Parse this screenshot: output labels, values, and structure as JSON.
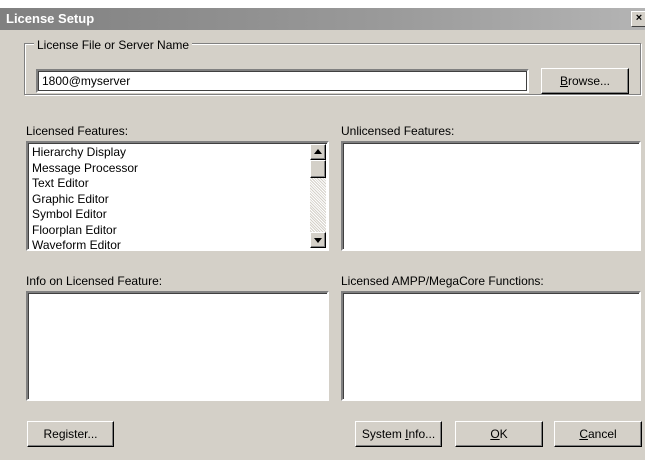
{
  "window": {
    "title": "License Setup",
    "close_glyph": "×"
  },
  "license_group": {
    "legend": "License File or Server Name",
    "value": "1800@myserver",
    "browse_label_underlined": "B",
    "browse_label_rest": "rowse..."
  },
  "licensed_features": {
    "label": "Licensed Features:",
    "items": [
      "Hierarchy Display",
      "Message Processor",
      "Text Editor",
      "Graphic Editor",
      "Symbol Editor",
      "Floorplan Editor",
      "Waveform Editor"
    ]
  },
  "unlicensed_features": {
    "label": "Unlicensed Features:",
    "items": []
  },
  "info_panel": {
    "label": "Info on Licensed Feature:"
  },
  "ampp_panel": {
    "label": "Licensed AMPP/MegaCore Functions:"
  },
  "buttons": {
    "register": "Register...",
    "system_info_prefix": "System ",
    "system_info_underlined": "I",
    "system_info_suffix": "nfo...",
    "ok_underlined": "O",
    "ok_rest": "K",
    "cancel_underlined": "C",
    "cancel_rest": "ancel"
  },
  "icons": {
    "scroll_up": "scroll-up-arrow-icon",
    "scroll_down": "scroll-down-arrow-icon",
    "close": "close-icon"
  },
  "colors": {
    "dialog_bg": "#d4d0c8",
    "titlebar": "#808080",
    "field_bg": "#ffffff"
  }
}
